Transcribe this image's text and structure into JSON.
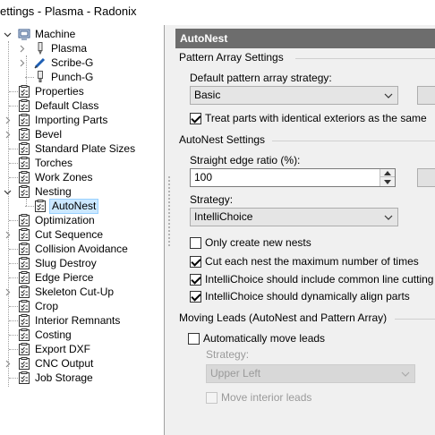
{
  "window": {
    "title": "ettings - Plasma - Radonix"
  },
  "tree": {
    "items": [
      {
        "label": "Machine",
        "expander": "minus",
        "icon": "machine-icon"
      },
      {
        "label": "Plasma",
        "expander": "right",
        "icon": "torch-icon"
      },
      {
        "label": "Scribe-G",
        "expander": "right",
        "icon": "scribe-icon"
      },
      {
        "label": "Punch-G",
        "expander": "none",
        "icon": "punch-icon"
      },
      {
        "label": "Properties",
        "icon": "checklist-icon"
      },
      {
        "label": "Default Class",
        "icon": "checklist-icon"
      },
      {
        "label": "Importing Parts",
        "expander": "right",
        "icon": "checklist-icon"
      },
      {
        "label": "Bevel",
        "expander": "right",
        "icon": "checklist-icon"
      },
      {
        "label": "Standard Plate Sizes",
        "icon": "checklist-icon"
      },
      {
        "label": "Torches",
        "icon": "checklist-icon"
      },
      {
        "label": "Work Zones",
        "icon": "checklist-icon"
      },
      {
        "label": "Nesting",
        "expander": "down",
        "icon": "checklist-icon"
      },
      {
        "label": "AutoNest",
        "icon": "checklist-icon",
        "selected": true
      },
      {
        "label": "Optimization",
        "icon": "checklist-icon"
      },
      {
        "label": "Cut Sequence",
        "expander": "right",
        "icon": "checklist-icon"
      },
      {
        "label": "Collision Avoidance",
        "icon": "checklist-icon"
      },
      {
        "label": "Slug Destroy",
        "icon": "checklist-icon"
      },
      {
        "label": "Edge Pierce",
        "icon": "checklist-icon"
      },
      {
        "label": "Skeleton Cut-Up",
        "expander": "right",
        "icon": "checklist-icon"
      },
      {
        "label": "Crop",
        "icon": "checklist-icon"
      },
      {
        "label": "Interior Remnants",
        "icon": "checklist-icon"
      },
      {
        "label": "Costing",
        "icon": "checklist-icon"
      },
      {
        "label": "Export DXF",
        "icon": "checklist-icon"
      },
      {
        "label": "CNC Output",
        "expander": "right",
        "icon": "checklist-icon"
      },
      {
        "label": "Job Storage",
        "icon": "checklist-icon"
      }
    ]
  },
  "panel": {
    "title": "AutoNest",
    "pattern_array": {
      "section": "Pattern Array Settings",
      "strategy_label": "Default pattern array strategy:",
      "strategy_value": "Basic",
      "identical_exteriors": {
        "label": "Treat parts with identical exteriors as the same",
        "checked": true
      }
    },
    "autonest": {
      "section": "AutoNest Settings",
      "straight_edge_label": "Straight edge ratio (%):",
      "straight_edge_value": "100",
      "strategy_label": "Strategy:",
      "strategy_value": "IntelliChoice",
      "options": [
        {
          "label": "Only create new nests",
          "checked": false
        },
        {
          "label": "Cut each nest the maximum number of times",
          "checked": true
        },
        {
          "label": "IntelliChoice should include common line cutting",
          "checked": true
        },
        {
          "label": "IntelliChoice should dynamically align parts",
          "checked": true
        }
      ]
    },
    "moving_leads": {
      "section": "Moving Leads (AutoNest and Pattern Array)",
      "auto_move": {
        "label": "Automatically move leads",
        "checked": false
      },
      "strategy_label": "Strategy:",
      "strategy_value": "Upper Left",
      "move_interior": {
        "label": "Move interior leads",
        "checked": false
      }
    }
  }
}
